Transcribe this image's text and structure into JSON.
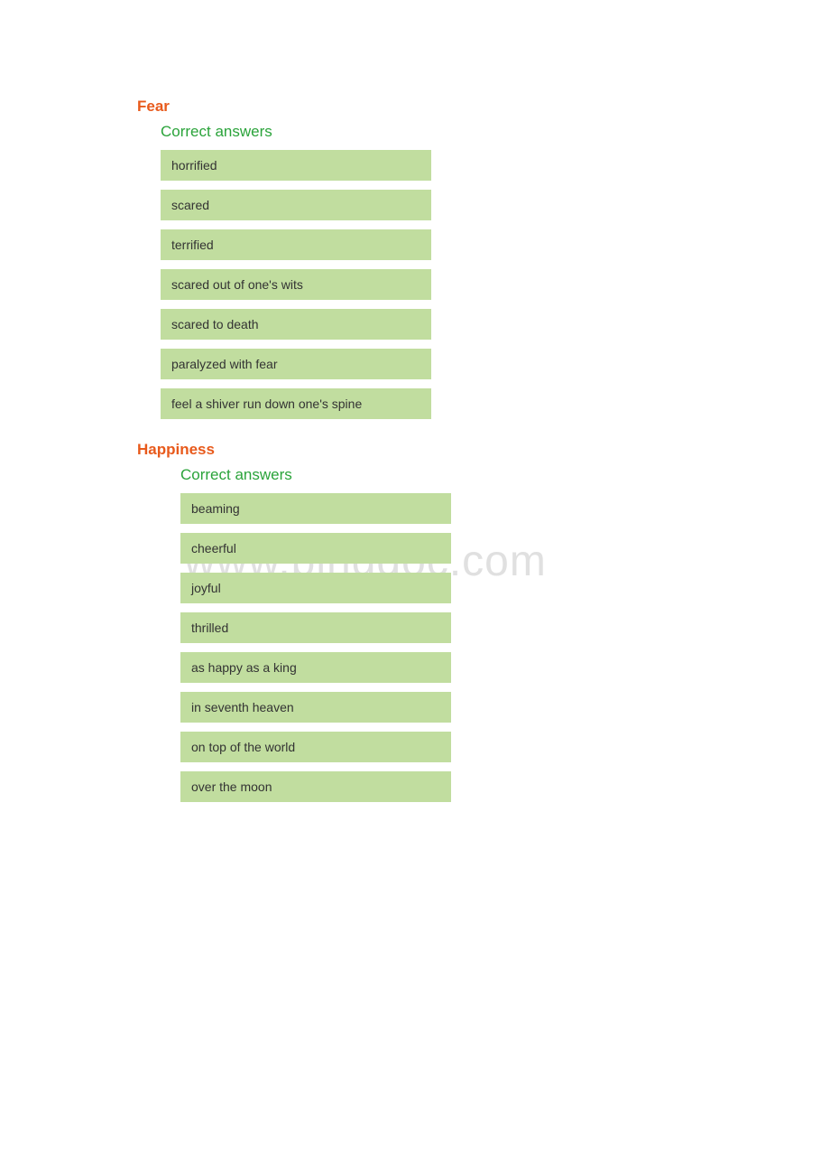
{
  "watermark": "www.bingdoc.com",
  "sections": [
    {
      "heading": "Fear",
      "subheading": "Correct answers",
      "indent": "indent-block",
      "answers": [
        "horrified",
        "scared",
        "terrified",
        "scared out of one's wits",
        "scared to death",
        "paralyzed with fear",
        "feel a shiver run down one's spine"
      ]
    },
    {
      "heading": "Happiness",
      "subheading": "Correct answers",
      "indent": "indent-block-2",
      "answers": [
        "beaming",
        "cheerful",
        "joyful",
        "thrilled",
        "as happy as a king",
        "in seventh heaven",
        "on top of the world",
        "over the moon"
      ]
    }
  ]
}
